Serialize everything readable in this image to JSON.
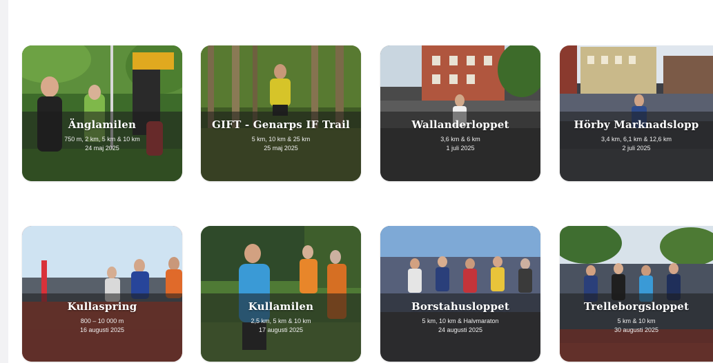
{
  "events": [
    {
      "title": "Änglamilen",
      "distances": "750 m, 2 km, 5 km & 10 km",
      "date": "24 maj 2025",
      "photo": "runner-photo-park"
    },
    {
      "title": "GIFT - Genarps IF Trail",
      "distances": "5 km, 10 km & 25 km",
      "date": "25 maj 2025",
      "photo": "runner-photo-forest"
    },
    {
      "title": "Wallanderloppet",
      "distances": "3,6 km & 6 km",
      "date": "1 juli 2025",
      "photo": "runner-photo-street"
    },
    {
      "title": "Hörby Marknadslopp",
      "distances": "3,4 km, 6,1 km & 12,6 km",
      "date": "2 juli 2025",
      "photo": "runner-photo-town"
    },
    {
      "title": "Kullaspring",
      "distances": "800 – 10 000 m",
      "date": "16 augusti 2025",
      "photo": "runner-photo-track"
    },
    {
      "title": "Kullamilen",
      "distances": "2,5 km, 5 km & 10 km",
      "date": "17 augusti 2025",
      "photo": "runner-photo-finish"
    },
    {
      "title": "Borstahusloppet",
      "distances": "5 km, 10 km & Halvmaraton",
      "date": "24 augusti 2025",
      "photo": "runner-photo-seaside"
    },
    {
      "title": "Trelleborgsloppet",
      "distances": "5 km & 10 km",
      "date": "30 augusti 2025",
      "photo": "runner-photo-start"
    }
  ],
  "colors": {
    "overlay": "#1c1c1c",
    "background": "#ffffff",
    "text": "#ffffff"
  }
}
